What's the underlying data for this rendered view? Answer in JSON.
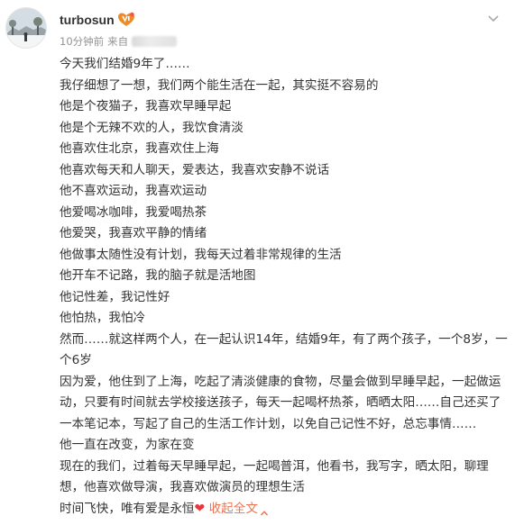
{
  "post": {
    "username": "turbosun",
    "time": "10分钟前",
    "source_prefix": "来自",
    "icons": {
      "vip": "vip-badge-icon",
      "more": "chevron-down-icon",
      "avatar": "snow-scene-avatar"
    },
    "colors": {
      "link": "#eb7350",
      "heart": "#e8383d",
      "meta": "#939393",
      "text": "#333333"
    },
    "lines": [
      "今天我们结婚9年了……",
      "我仔细想了一想，我们两个能生活在一起，其实挺不容易的",
      "他是个夜猫子，我喜欢早睡早起",
      "他是个无辣不欢的人，我饮食清淡",
      "他喜欢住北京，我喜欢住上海",
      "他喜欢每天和人聊天，爱表达，我喜欢安静不说话",
      "他不喜欢运动，我喜欢运动",
      "他爱喝冰咖啡，我爱喝热茶",
      "他爱哭，我喜欢平静的情绪",
      "他做事太随性没有计划，我每天过着非常规律的生活",
      "他开车不记路，我的脑子就是活地图",
      "他记性差，我记性好",
      "他怕热，我怕冷",
      "然而……就这样两个人，在一起认识14年，结婚9年，有了两个孩子，一个8岁，一个6岁",
      "因为爱，他住到了上海，吃起了清淡健康的食物，尽量会做到早睡早起，一起做运动，只要有时间就去学校接送孩子，每天一起喝杯热茶，晒晒太阳……自己还买了一本笔记本，写起了自己的生活工作计划，以免自己记性不好，总忘事情……",
      "他一直在改变，为家在变",
      "现在的我们，过着每天早睡早起，一起喝普洱，他看书，我写字，晒太阳，聊理想，他喜欢做导演，我喜欢做演员的理想生活"
    ],
    "last_line_text": "时间飞快，唯有爱是永恒",
    "heart_glyph": "❤",
    "expand_label": "收起全文"
  }
}
